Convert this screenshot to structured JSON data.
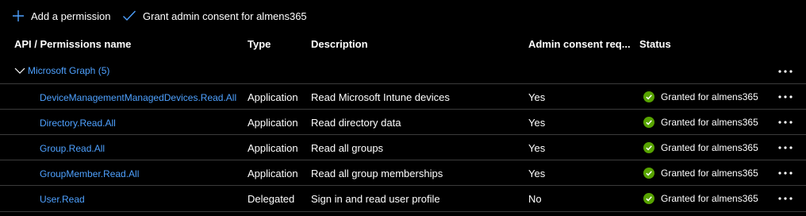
{
  "toolbar": {
    "add_label": "Add a permission",
    "grant_label": "Grant admin consent for almens365"
  },
  "columns": {
    "name": "API / Permissions name",
    "type": "Type",
    "description": "Description",
    "admin": "Admin consent req...",
    "status": "Status"
  },
  "group": {
    "label": "Microsoft Graph (5)"
  },
  "rows": [
    {
      "name": "DeviceManagementManagedDevices.Read.All",
      "type": "Application",
      "description": "Read Microsoft Intune devices",
      "admin": "Yes",
      "status": "Granted for almens365"
    },
    {
      "name": "Directory.Read.All",
      "type": "Application",
      "description": "Read directory data",
      "admin": "Yes",
      "status": "Granted for almens365"
    },
    {
      "name": "Group.Read.All",
      "type": "Application",
      "description": "Read all groups",
      "admin": "Yes",
      "status": "Granted for almens365"
    },
    {
      "name": "GroupMember.Read.All",
      "type": "Application",
      "description": "Read all group memberships",
      "admin": "Yes",
      "status": "Granted for almens365"
    },
    {
      "name": "User.Read",
      "type": "Delegated",
      "description": "Sign in and read user profile",
      "admin": "No",
      "status": "Granted for almens365"
    }
  ],
  "colors": {
    "background": "#000000",
    "link": "#4ea1ff",
    "granted": "#57a300",
    "divider": "#3b3b3b"
  },
  "icons": {
    "add": "plus-icon",
    "grant": "checkmark-icon",
    "expand": "chevron-down-icon",
    "more": "more-horizontal-icon",
    "status": "check-circle-icon"
  }
}
